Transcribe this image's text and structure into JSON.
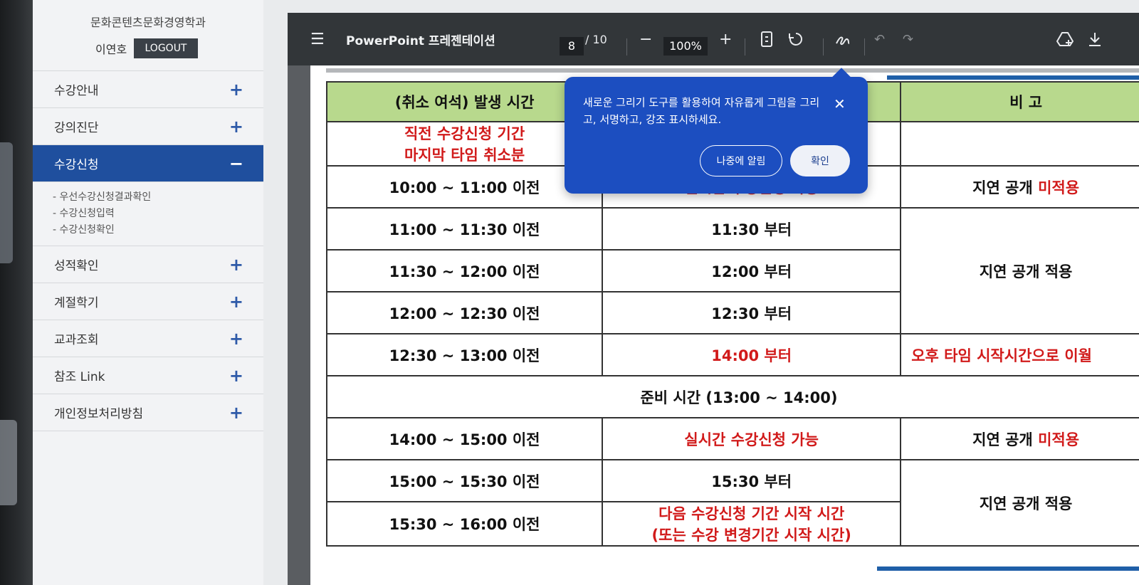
{
  "sidebar": {
    "department": "문화콘텐츠문화경영학과",
    "user_name": "이연호",
    "logout_label": "LOGOUT",
    "items": [
      {
        "label": "수강안내",
        "toggle": "+"
      },
      {
        "label": "강의진단",
        "toggle": "+"
      },
      {
        "label": "수강신청",
        "toggle": "−"
      },
      {
        "label": "성적확인",
        "toggle": "+"
      },
      {
        "label": "계절학기",
        "toggle": "+"
      },
      {
        "label": "교과조회",
        "toggle": "+"
      },
      {
        "label": "참조 Link",
        "toggle": "+"
      },
      {
        "label": "개인정보처리방침",
        "toggle": "+"
      }
    ],
    "submenu": [
      "- 우선수강신청결과확인",
      "- 수강신청입력",
      "- 수강신청확인"
    ]
  },
  "viewer": {
    "title": "PowerPoint 프레젠테이션",
    "page_current": "8",
    "page_total": "/ 10",
    "zoom": "100%",
    "zoom_minus": "−",
    "zoom_plus": "+"
  },
  "popover": {
    "message": "새로운 그리기 도구를 활용하여 자유롭게 그림을 그리고, 서명하고, 강조 표시하세요.",
    "close": "✕",
    "later_label": "나중에 알림",
    "ok_label": "확인"
  },
  "table": {
    "header": [
      "(취소 여석) 발생 시간",
      "",
      "비 고"
    ],
    "first_row_lines": [
      "직전 수강신청 기간",
      "마지막 타임 취소분"
    ],
    "rows": [
      {
        "time": "10:00 ~ 11:00 이전",
        "open": "실시간 수강신청 가능",
        "note_a": "지연 공개 ",
        "note_b": "미적용"
      },
      {
        "time": "11:00 ~ 11:30 이전",
        "open": "11:30 부터"
      },
      {
        "time": "11:30 ~ 12:00 이전",
        "open": "12:00 부터",
        "note": "지연 공개 적용"
      },
      {
        "time": "12:00 ~ 12:30 이전",
        "open": "12:30 부터"
      },
      {
        "time": "12:30 ~ 13:00 이전",
        "open": "14:00 부터",
        "note": "오후 타임 시작시간으로 이월"
      }
    ],
    "prep": "준비 시간 (13:00 ~ 14:00)",
    "rows2": [
      {
        "time": "14:00 ~ 15:00 이전",
        "open": "실시간 수강신청 가능",
        "note_a": "지연 공개 ",
        "note_b": "미적용"
      },
      {
        "time": "15:00 ~ 15:30 이전",
        "open": "15:30 부터",
        "note": "지연 공개 적용"
      },
      {
        "time": "15:30 ~ 16:00 이전",
        "open_lines": [
          "다음 수강신청 기간 시작 시간",
          "(또는 수강 변경기간 시작 시간)"
        ]
      }
    ]
  }
}
